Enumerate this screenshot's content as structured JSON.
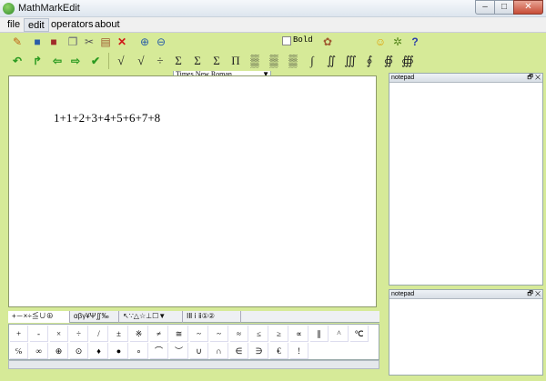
{
  "window": {
    "title": "MathMarkEdit",
    "min": "–",
    "max": "□",
    "close": "✕"
  },
  "menu": [
    "file",
    "edit",
    "operators",
    "about"
  ],
  "toolbar": {
    "font": "Times New Roman",
    "bold_label": "Bold"
  },
  "operators_bar": [
    "√",
    "√",
    "÷",
    "Σ",
    "Σ",
    "Σ",
    "Π",
    "▒",
    "▒",
    "▒",
    "∫",
    "∬",
    "∭",
    "∮",
    "∯",
    "∰"
  ],
  "editor": {
    "formula": "1+1+2+3+4+5+6+7+8"
  },
  "symbol_tabs": [
    "+－×÷≦∪⊕",
    "αβγ¥Ψ∬‰",
    "↖∵△☆⊥☐▼",
    "ⅠⅡ ⅰ ⅱ①②"
  ],
  "symbols_row1": [
    "+",
    "-",
    "×",
    "÷",
    "/",
    "±",
    "※",
    "≠",
    "≅",
    "~",
    "~",
    "≈",
    "≤",
    "≥",
    "∝",
    "∥",
    "^",
    "℃"
  ],
  "symbols_row2": [
    "℅",
    "∞",
    "⊕",
    "⊙",
    "♦",
    "●",
    "∘",
    "⌒",
    "︶",
    "∪",
    "∩",
    "∈",
    "∋",
    "€",
    "!"
  ],
  "panels": [
    {
      "title": "notepad"
    },
    {
      "title": "notepad"
    }
  ],
  "panel_btns": "🗗 ✕"
}
